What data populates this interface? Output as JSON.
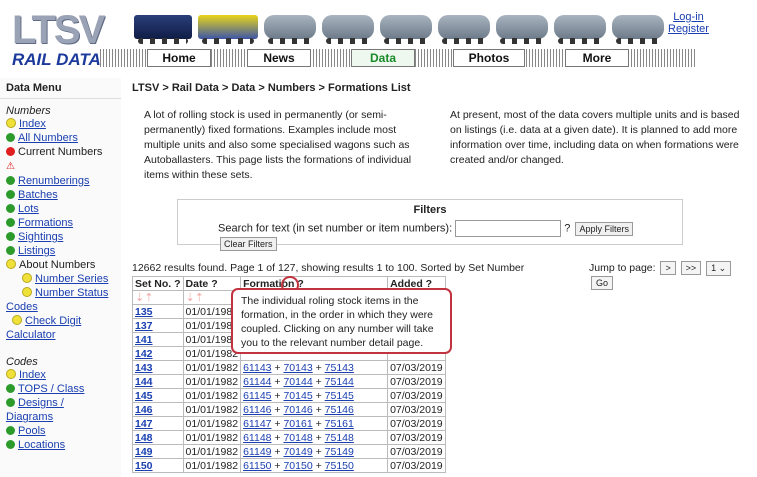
{
  "header": {
    "logo_text": "LTSV",
    "logo_sub": "RAIL DATA",
    "login": "Log-in",
    "register": "Register",
    "nav": [
      "Home",
      "News",
      "Data",
      "Photos",
      "More"
    ]
  },
  "sidebar": {
    "title": "Data Menu",
    "numbers_heading": "Numbers",
    "numbers": [
      "Index",
      "All Numbers",
      "Current Numbers",
      "Renumberings",
      "Batches",
      "Lots",
      "Formations",
      "Sightings",
      "Listings",
      "About Numbers",
      "Number Series",
      "Number Status"
    ],
    "codes_link": "Codes",
    "check_digit": "Check Digit",
    "calculator": "Calculator",
    "codes_heading": "Codes",
    "codes": [
      "Index",
      "TOPS / Class",
      "Designs / Diagrams",
      "Pools",
      "Locations"
    ]
  },
  "main": {
    "breadcrumb": "LTSV > Rail Data > Data > Numbers > Formations List",
    "intro_left": "A lot of rolling stock is used in permanently (or semi-permanently) fixed formations. Examples include most multiple units and also some specialised wagons such as Autoballasters. This page lists the formations of individual items within these sets.",
    "intro_right": "At present, most of the data covers multiple units and is based on listings (i.e. data at a given date). It is planned to add more information over time, including data on when formations were created and/or changed.",
    "filters": {
      "title": "Filters",
      "label": "Search for text (in set number or item numbers):",
      "value": "",
      "help": "?",
      "apply": "Apply Filters",
      "clear": "Clear Filters"
    },
    "summary": "12662 results found. Page 1 of 127, showing results 1 to 100. Sorted by Set Number",
    "jump_label": "Jump to page:",
    "jump_next": ">",
    "jump_last": ">>",
    "jump_page": "1",
    "jump_go": "Go",
    "columns": [
      "Set No. ?",
      "Date ?",
      "Formation ?",
      "Added ?"
    ],
    "rows": [
      {
        "set": "135",
        "date": "01/01/1982",
        "formation": [],
        "added": ""
      },
      {
        "set": "137",
        "date": "01/01/1982",
        "formation": [],
        "added": ""
      },
      {
        "set": "141",
        "date": "01/01/1982",
        "formation": [],
        "added": ""
      },
      {
        "set": "142",
        "date": "01/01/1982",
        "formation": [],
        "added": ""
      },
      {
        "set": "143",
        "date": "01/01/1982",
        "formation": [
          "61143",
          "70143",
          "75143"
        ],
        "added": "07/03/2019"
      },
      {
        "set": "144",
        "date": "01/01/1982",
        "formation": [
          "61144",
          "70144",
          "75144"
        ],
        "added": "07/03/2019"
      },
      {
        "set": "145",
        "date": "01/01/1982",
        "formation": [
          "61145",
          "70145",
          "75145"
        ],
        "added": "07/03/2019"
      },
      {
        "set": "146",
        "date": "01/01/1982",
        "formation": [
          "61146",
          "70146",
          "75146"
        ],
        "added": "07/03/2019"
      },
      {
        "set": "147",
        "date": "01/01/1982",
        "formation": [
          "61147",
          "70161",
          "75161"
        ],
        "added": "07/03/2019"
      },
      {
        "set": "148",
        "date": "01/01/1982",
        "formation": [
          "61148",
          "70148",
          "75148"
        ],
        "added": "07/03/2019"
      },
      {
        "set": "149",
        "date": "01/01/1982",
        "formation": [
          "61149",
          "70149",
          "75149"
        ],
        "added": "07/03/2019"
      },
      {
        "set": "150",
        "date": "01/01/1982",
        "formation": [
          "61150",
          "70150",
          "75150"
        ],
        "added": "07/03/2019"
      }
    ],
    "tooltip": "The individual roling stock items in the formation, in the order in which they were coupled. Clicking on any number will take you to the relevant number detail page."
  },
  "colors": {
    "link": "#1a3fb0",
    "accent_green": "#2c9b2c",
    "tooltip_border": "#c0333f"
  }
}
